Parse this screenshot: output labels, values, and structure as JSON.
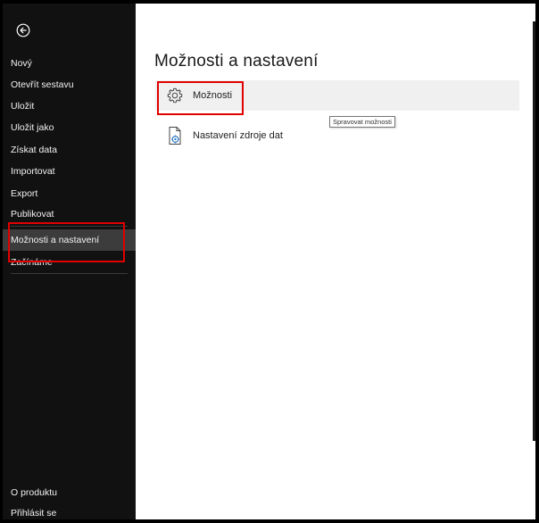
{
  "sidebar": {
    "back_icon": "back-arrow-circle-icon",
    "items": [
      {
        "label": "Nový"
      },
      {
        "label": "Otevřít sestavu"
      },
      {
        "label": "Uložit"
      },
      {
        "label": "Uložit jako"
      },
      {
        "label": "Získat data"
      },
      {
        "label": "Importovat"
      },
      {
        "label": "Export"
      },
      {
        "label": "Publikovat"
      },
      {
        "label": "Možnosti a nastavení"
      },
      {
        "label": "Začínáme"
      }
    ],
    "bottom_items": [
      {
        "label": "O produktu"
      },
      {
        "label": "Přihlásit se"
      }
    ]
  },
  "main": {
    "title": "Možnosti a nastavení",
    "options": [
      {
        "label": "Možnosti",
        "icon": "gear-icon"
      },
      {
        "label": "Nastavení zdroje dat",
        "icon": "data-source-settings-icon"
      }
    ],
    "tooltip": "Spravovat možnosti"
  },
  "colors": {
    "sidebar_bg": "#111111",
    "active_item_bg": "#3c3c3c",
    "highlight_box": "#e00000"
  }
}
